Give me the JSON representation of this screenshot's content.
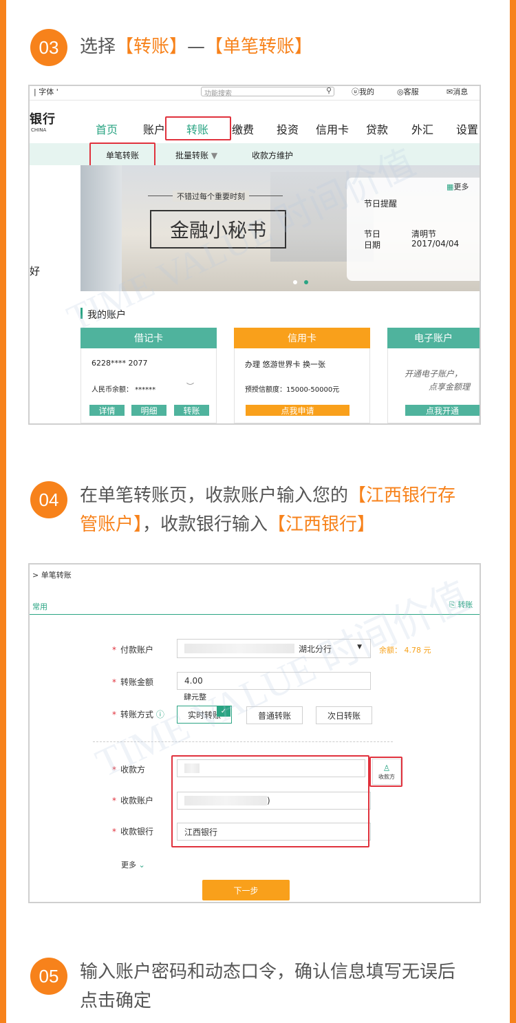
{
  "steps": [
    {
      "num": "03",
      "text_a": "选择",
      "hl_a": "【转账】",
      "text_b": "—",
      "hl_b": "【单笔转账】"
    },
    {
      "num": "04",
      "text_a": "在单笔转账页，收款账户输入您的",
      "hl_a": "【江西银行存管账户】",
      "text_b": "，收款银行输入",
      "hl_b": "【江西银行】"
    },
    {
      "num": "05",
      "text_a": "输入账户密码和动态口令，确认信息填写无误后点击确定"
    }
  ],
  "shot1": {
    "topbar": {
      "font": "字体",
      "search_placeholder": "功能搜索",
      "mine": "我的",
      "service": "客服",
      "message": "消息"
    },
    "bank_name": "银行",
    "bank_en": "CHINA",
    "nav": [
      "首页",
      "账户",
      "转账",
      "缴费",
      "投资",
      "信用卡",
      "贷款",
      "外汇",
      "设置"
    ],
    "subnav": [
      "单笔转账",
      "批量转账",
      "收款方维护"
    ],
    "banner": {
      "tagline": "不错过每个重要时刻",
      "title": "金融小秘书"
    },
    "reminder": {
      "more": "更多",
      "title": "节日提醒",
      "k1": "节日",
      "v1": "清明节",
      "k2": "日期",
      "v2": "2017/04/04"
    },
    "greeting": "好",
    "accounts_title": "我的账户",
    "cards": [
      {
        "header": "借记卡",
        "line1": "6228**** 2077",
        "line2": "人民币余额： ******",
        "buttons": [
          "详情",
          "明细",
          "转账"
        ]
      },
      {
        "header": "信用卡",
        "line1": "办理 悠游世界卡 换一张",
        "line2": "预授信额度：15000-50000元",
        "button": "点我申请"
      },
      {
        "header": "电子账户",
        "line1": "开通电子账户，",
        "line2": "点享金额理",
        "button": "点我开通"
      }
    ],
    "watermark": "TIME VALUE 时间价值"
  },
  "shot2": {
    "breadcrumb": "> 单笔转账",
    "tab": "常用",
    "tab_right": "转账",
    "fields": {
      "pay_label": "付款账户",
      "pay_branch": "湖北分行",
      "balance": "余额：  4.78 元",
      "amount_label": "转账金额",
      "amount_value": "4.00",
      "amount_words": "肆元整",
      "method_label": "转账方式",
      "methods": [
        "实时转账",
        "普通转账",
        "次日转账"
      ],
      "payee_label": "收款方",
      "payee_icon_label": "收款方",
      "acct_label": "收款账户",
      "acct_suffix": ")",
      "bank_label": "收款银行",
      "bank_value": "江西银行",
      "more": "更多",
      "next": "下一步"
    }
  },
  "colors": {
    "orange": "#f7821b",
    "teal": "#4fb39d",
    "red": "#e0313c"
  }
}
